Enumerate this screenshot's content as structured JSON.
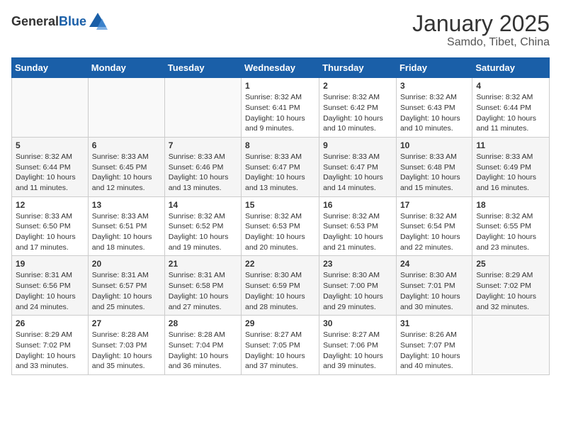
{
  "header": {
    "logo_general": "General",
    "logo_blue": "Blue",
    "title": "January 2025",
    "subtitle": "Samdo, Tibet, China"
  },
  "days_of_week": [
    "Sunday",
    "Monday",
    "Tuesday",
    "Wednesday",
    "Thursday",
    "Friday",
    "Saturday"
  ],
  "weeks": [
    [
      {
        "day": "",
        "info": ""
      },
      {
        "day": "",
        "info": ""
      },
      {
        "day": "",
        "info": ""
      },
      {
        "day": "1",
        "info": "Sunrise: 8:32 AM\nSunset: 6:41 PM\nDaylight: 10 hours and 9 minutes."
      },
      {
        "day": "2",
        "info": "Sunrise: 8:32 AM\nSunset: 6:42 PM\nDaylight: 10 hours and 10 minutes."
      },
      {
        "day": "3",
        "info": "Sunrise: 8:32 AM\nSunset: 6:43 PM\nDaylight: 10 hours and 10 minutes."
      },
      {
        "day": "4",
        "info": "Sunrise: 8:32 AM\nSunset: 6:44 PM\nDaylight: 10 hours and 11 minutes."
      }
    ],
    [
      {
        "day": "5",
        "info": "Sunrise: 8:32 AM\nSunset: 6:44 PM\nDaylight: 10 hours and 11 minutes."
      },
      {
        "day": "6",
        "info": "Sunrise: 8:33 AM\nSunset: 6:45 PM\nDaylight: 10 hours and 12 minutes."
      },
      {
        "day": "7",
        "info": "Sunrise: 8:33 AM\nSunset: 6:46 PM\nDaylight: 10 hours and 13 minutes."
      },
      {
        "day": "8",
        "info": "Sunrise: 8:33 AM\nSunset: 6:47 PM\nDaylight: 10 hours and 13 minutes."
      },
      {
        "day": "9",
        "info": "Sunrise: 8:33 AM\nSunset: 6:47 PM\nDaylight: 10 hours and 14 minutes."
      },
      {
        "day": "10",
        "info": "Sunrise: 8:33 AM\nSunset: 6:48 PM\nDaylight: 10 hours and 15 minutes."
      },
      {
        "day": "11",
        "info": "Sunrise: 8:33 AM\nSunset: 6:49 PM\nDaylight: 10 hours and 16 minutes."
      }
    ],
    [
      {
        "day": "12",
        "info": "Sunrise: 8:33 AM\nSunset: 6:50 PM\nDaylight: 10 hours and 17 minutes."
      },
      {
        "day": "13",
        "info": "Sunrise: 8:33 AM\nSunset: 6:51 PM\nDaylight: 10 hours and 18 minutes."
      },
      {
        "day": "14",
        "info": "Sunrise: 8:32 AM\nSunset: 6:52 PM\nDaylight: 10 hours and 19 minutes."
      },
      {
        "day": "15",
        "info": "Sunrise: 8:32 AM\nSunset: 6:53 PM\nDaylight: 10 hours and 20 minutes."
      },
      {
        "day": "16",
        "info": "Sunrise: 8:32 AM\nSunset: 6:53 PM\nDaylight: 10 hours and 21 minutes."
      },
      {
        "day": "17",
        "info": "Sunrise: 8:32 AM\nSunset: 6:54 PM\nDaylight: 10 hours and 22 minutes."
      },
      {
        "day": "18",
        "info": "Sunrise: 8:32 AM\nSunset: 6:55 PM\nDaylight: 10 hours and 23 minutes."
      }
    ],
    [
      {
        "day": "19",
        "info": "Sunrise: 8:31 AM\nSunset: 6:56 PM\nDaylight: 10 hours and 24 minutes."
      },
      {
        "day": "20",
        "info": "Sunrise: 8:31 AM\nSunset: 6:57 PM\nDaylight: 10 hours and 25 minutes."
      },
      {
        "day": "21",
        "info": "Sunrise: 8:31 AM\nSunset: 6:58 PM\nDaylight: 10 hours and 27 minutes."
      },
      {
        "day": "22",
        "info": "Sunrise: 8:30 AM\nSunset: 6:59 PM\nDaylight: 10 hours and 28 minutes."
      },
      {
        "day": "23",
        "info": "Sunrise: 8:30 AM\nSunset: 7:00 PM\nDaylight: 10 hours and 29 minutes."
      },
      {
        "day": "24",
        "info": "Sunrise: 8:30 AM\nSunset: 7:01 PM\nDaylight: 10 hours and 30 minutes."
      },
      {
        "day": "25",
        "info": "Sunrise: 8:29 AM\nSunset: 7:02 PM\nDaylight: 10 hours and 32 minutes."
      }
    ],
    [
      {
        "day": "26",
        "info": "Sunrise: 8:29 AM\nSunset: 7:02 PM\nDaylight: 10 hours and 33 minutes."
      },
      {
        "day": "27",
        "info": "Sunrise: 8:28 AM\nSunset: 7:03 PM\nDaylight: 10 hours and 35 minutes."
      },
      {
        "day": "28",
        "info": "Sunrise: 8:28 AM\nSunset: 7:04 PM\nDaylight: 10 hours and 36 minutes."
      },
      {
        "day": "29",
        "info": "Sunrise: 8:27 AM\nSunset: 7:05 PM\nDaylight: 10 hours and 37 minutes."
      },
      {
        "day": "30",
        "info": "Sunrise: 8:27 AM\nSunset: 7:06 PM\nDaylight: 10 hours and 39 minutes."
      },
      {
        "day": "31",
        "info": "Sunrise: 8:26 AM\nSunset: 7:07 PM\nDaylight: 10 hours and 40 minutes."
      },
      {
        "day": "",
        "info": ""
      }
    ]
  ]
}
